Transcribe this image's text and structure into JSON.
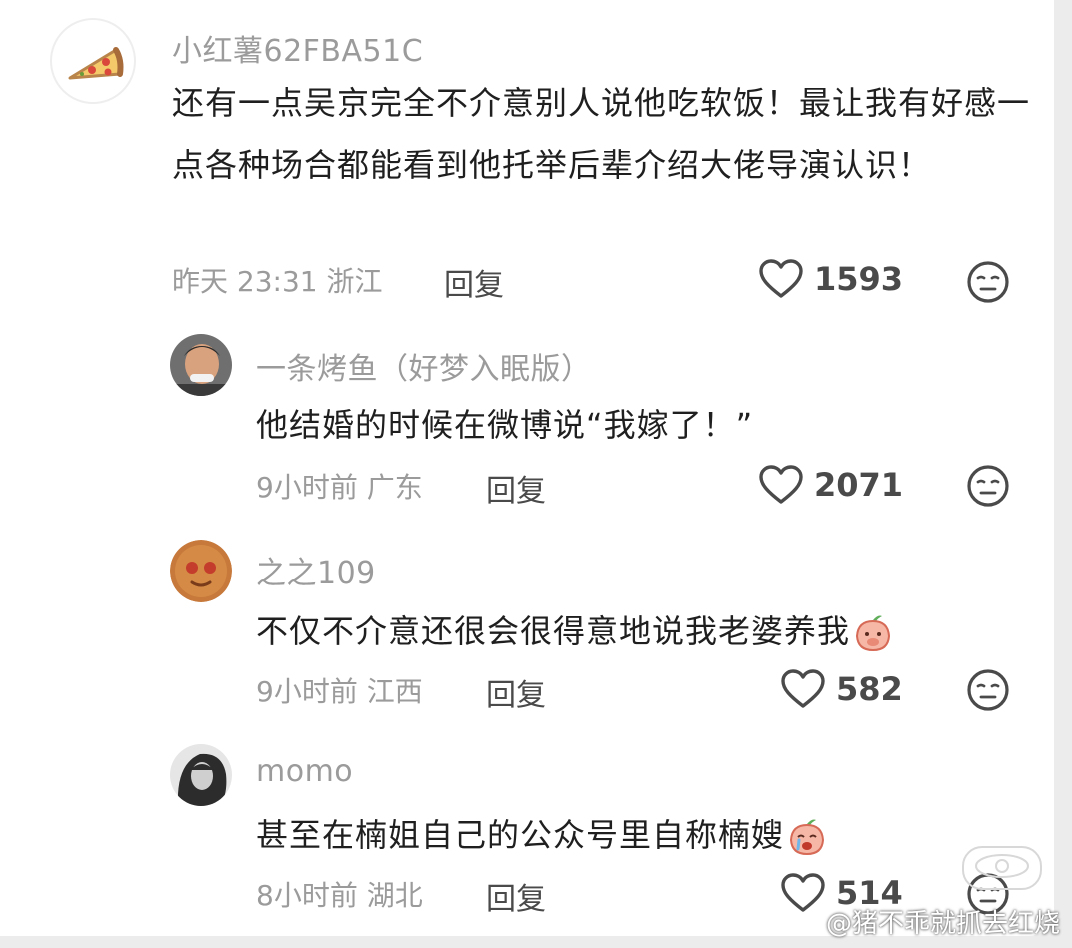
{
  "comments": [
    {
      "username": "小红薯62FBA51C",
      "text": "还有一点吴京完全不介意别人说他吃软饭！最让我有好感一点各种场合都能看到他托举后辈介绍大佬导演认识！",
      "time": "昨天 23:31 浙江",
      "reply_label": "回复",
      "likes": "1593"
    },
    {
      "username": "一条烤鱼（好梦入眠版）",
      "text": "他结婚的时候在微博说“我嫁了！”",
      "time": "9小时前 广东",
      "reply_label": "回复",
      "likes": "2071"
    },
    {
      "username": "之之109",
      "text": "不仅不介意还很会很得意地说我老婆养我",
      "time": "9小时前 江西",
      "reply_label": "回复",
      "likes": "582"
    },
    {
      "username": "momo",
      "text": "甚至在楠姐自己的公众号里自称楠嫂",
      "time": "8小时前 湖北",
      "reply_label": "回复",
      "likes": "514"
    }
  ],
  "watermark": "@猪不乖就抓去红烧",
  "icons": {
    "like": "heart-outline-icon",
    "dislike": "meh-face-icon",
    "emoji": "peach-emoji-icon"
  },
  "colors": {
    "text": "#1f1f1f",
    "muted": "#9b9b9b",
    "icon": "#4a4a4a"
  }
}
